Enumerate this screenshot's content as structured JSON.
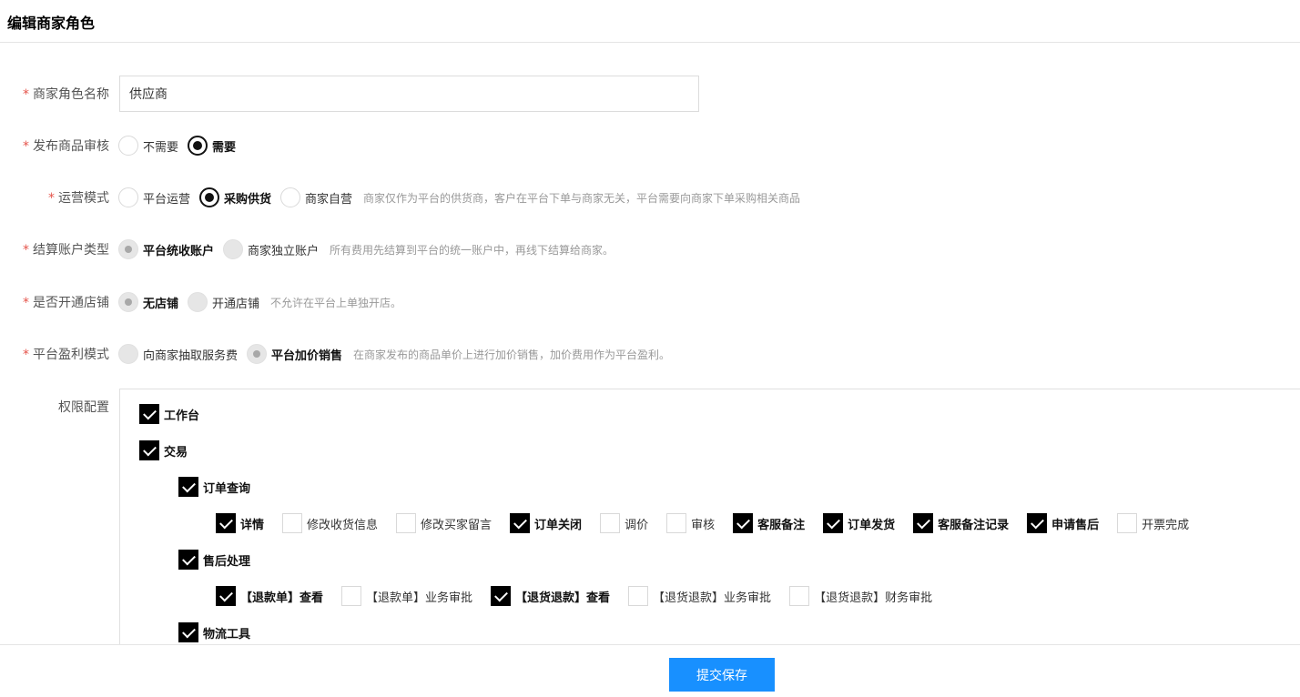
{
  "header": {
    "title": "编辑商家角色"
  },
  "form": {
    "role_name": {
      "label": "商家角色名称",
      "value": "供应商"
    },
    "audit": {
      "label": "发布商品审核",
      "options": [
        "不需要",
        "需要"
      ],
      "selected": "需要"
    },
    "mode": {
      "label": "运营模式",
      "options": [
        "平台运营",
        "采购供货",
        "商家自营"
      ],
      "selected": "采购供货",
      "hint": "商家仅作为平台的供货商，客户在平台下单与商家无关，平台需要向商家下单采购相关商品"
    },
    "account": {
      "label": "结算账户类型",
      "options": [
        "平台统收账户",
        "商家独立账户"
      ],
      "selected": "平台统收账户",
      "hint": "所有费用先结算到平台的统一账户中，再线下结算给商家。"
    },
    "store": {
      "label": "是否开通店铺",
      "options": [
        "无店铺",
        "开通店铺"
      ],
      "selected": "无店铺",
      "hint": "不允许在平台上单独开店。"
    },
    "profit": {
      "label": "平台盈利模式",
      "options": [
        "向商家抽取服务费",
        "平台加价销售"
      ],
      "selected": "平台加价销售",
      "hint": "在商家发布的商品单价上进行加价销售，加价费用作为平台盈利。"
    },
    "required_mark": "*"
  },
  "permissions": {
    "label": "权限配置",
    "workbench": {
      "label": "工作台",
      "checked": true
    },
    "trade": {
      "label": "交易",
      "checked": true
    },
    "order_query": {
      "label": "订单查询",
      "checked": true,
      "items": [
        {
          "label": "详情",
          "checked": true
        },
        {
          "label": "修改收货信息",
          "checked": false
        },
        {
          "label": "修改买家留言",
          "checked": false
        },
        {
          "label": "订单关闭",
          "checked": true
        },
        {
          "label": "调价",
          "checked": false
        },
        {
          "label": "审核",
          "checked": false
        },
        {
          "label": "客服备注",
          "checked": true
        },
        {
          "label": "订单发货",
          "checked": true
        },
        {
          "label": "客服备注记录",
          "checked": true
        },
        {
          "label": "申请售后",
          "checked": true
        },
        {
          "label": "开票完成",
          "checked": false
        }
      ]
    },
    "after_sales": {
      "label": "售后处理",
      "checked": true,
      "items": [
        {
          "label": "【退款单】查看",
          "checked": true
        },
        {
          "label": "【退款单】业务审批",
          "checked": false
        },
        {
          "label": "【退货退款】查看",
          "checked": true
        },
        {
          "label": "【退货退款】业务审批",
          "checked": false
        },
        {
          "label": "【退货退款】财务审批",
          "checked": false
        }
      ]
    },
    "logistics": {
      "label": "物流工具",
      "checked": true
    }
  },
  "footer": {
    "submit_label": "提交保存"
  }
}
